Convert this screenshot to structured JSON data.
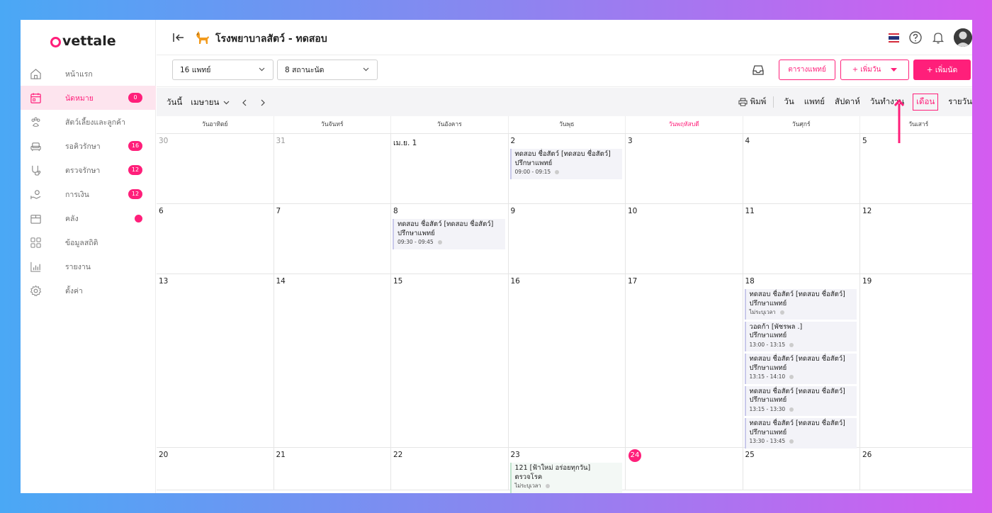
{
  "logo": {
    "text": "vettale"
  },
  "sidebar": {
    "items": [
      {
        "label": "หน้าแรก",
        "icon": "home-icon",
        "active": false,
        "badge": ""
      },
      {
        "label": "นัดหมาย",
        "icon": "calendar-icon",
        "active": true,
        "badge": "0"
      },
      {
        "label": "สัตว์เลี้ยงและลูกค้า",
        "icon": "paw-icon",
        "active": false,
        "badge": ""
      },
      {
        "label": "รอคิวรักษา",
        "icon": "sofa-icon",
        "active": false,
        "badge": "16"
      },
      {
        "label": "ตรวจรักษา",
        "icon": "stethoscope-icon",
        "active": false,
        "badge": "12"
      },
      {
        "label": "การเงิน",
        "icon": "payment-hand-icon",
        "active": false,
        "badge": "12"
      },
      {
        "label": "คลัง",
        "icon": "box-icon",
        "active": false,
        "badge": ""
      },
      {
        "label": "ข้อมูลสถิติ",
        "icon": "grid-stats-icon",
        "active": false,
        "badge": ""
      },
      {
        "label": "รายงาน",
        "icon": "bar-chart-icon",
        "active": false,
        "badge": ""
      },
      {
        "label": "ตั้งค่า",
        "icon": "gear-icon",
        "active": false,
        "badge": ""
      }
    ]
  },
  "topbar": {
    "title": "โรงพยาบาลสัตว์ - ทดสอบ"
  },
  "toolbar": {
    "doctor_select": "16 แพทย์",
    "status_select": "8 สถานะนัด",
    "schedule_btn": "ตารางแพทย์",
    "add_day_btn": "+ เพิ่มวัน",
    "add_appt_btn": "+ เพิ่มนัด"
  },
  "calendar_header": {
    "today": "วันนี้",
    "month": "เมษายน",
    "print": "พิมพ์",
    "views": [
      "วัน",
      "แพทย์",
      "สัปดาห์",
      "วันทำงาน",
      "เดือน",
      "รายวัน"
    ],
    "active_view": "เดือน"
  },
  "colors": {
    "accent": "#ff1f7a"
  },
  "weekdays": [
    "วันอาทิตย์",
    "วันจันทร์",
    "วันอังคาร",
    "วันพุธ",
    "วันพฤหัสบดี",
    "วันศุกร์",
    "วันเสาร์"
  ],
  "weeks": [
    {
      "days": [
        {
          "n": "30",
          "muted": true,
          "events": []
        },
        {
          "n": "31",
          "muted": true,
          "events": []
        },
        {
          "n": "เม.ย. 1",
          "events": []
        },
        {
          "n": "2",
          "events": [
            {
              "title": "ทดสอบ ชื่อสัตว์ [ทดสอบ ชื่อสัตว์]",
              "type": "ปรึกษาแพทย์",
              "time": "09:00 - 09:15"
            }
          ]
        },
        {
          "n": "3",
          "events": []
        },
        {
          "n": "4",
          "events": []
        },
        {
          "n": "5",
          "events": []
        }
      ]
    },
    {
      "days": [
        {
          "n": "6",
          "events": []
        },
        {
          "n": "7",
          "events": []
        },
        {
          "n": "8",
          "events": [
            {
              "title": "ทดสอบ ชื่อสัตว์ [ทดสอบ ชื่อสัตว์]",
              "type": "ปรึกษาแพทย์",
              "time": "09:30 - 09:45"
            }
          ]
        },
        {
          "n": "9",
          "events": []
        },
        {
          "n": "10",
          "events": []
        },
        {
          "n": "11",
          "events": []
        },
        {
          "n": "12",
          "events": []
        }
      ]
    },
    {
      "days": [
        {
          "n": "13",
          "events": []
        },
        {
          "n": "14",
          "events": []
        },
        {
          "n": "15",
          "events": []
        },
        {
          "n": "16",
          "events": []
        },
        {
          "n": "17",
          "events": []
        },
        {
          "n": "18",
          "events": [
            {
              "title": "ทดสอบ ชื่อสัตว์ [ทดสอบ ชื่อสัตว์]",
              "type": "ปรึกษาแพทย์",
              "time": "ไม่ระบุเวลา"
            },
            {
              "title": "วอดก้า [พัชรพล .]",
              "type": "ปรึกษาแพทย์",
              "time": "13:00 - 13:15"
            },
            {
              "title": "ทดสอบ ชื่อสัตว์ [ทดสอบ ชื่อสัตว์]",
              "type": "ปรึกษาแพทย์",
              "time": "13:15 - 14:10"
            },
            {
              "title": "ทดสอบ ชื่อสัตว์ [ทดสอบ ชื่อสัตว์]",
              "type": "ปรึกษาแพทย์",
              "time": "13:15 - 13:30"
            },
            {
              "title": "ทดสอบ ชื่อสัตว์ [ทดสอบ ชื่อสัตว์]",
              "type": "ปรึกษาแพทย์",
              "time": "13:30 - 13:45"
            }
          ]
        },
        {
          "n": "19",
          "events": []
        }
      ]
    },
    {
      "days": [
        {
          "n": "20",
          "events": []
        },
        {
          "n": "21",
          "events": []
        },
        {
          "n": "22",
          "events": []
        },
        {
          "n": "23",
          "events": [
            {
              "title": "121 [ฟ้าใหม่ อร่อยทุกวัน]",
              "type": "ตรวจโรค",
              "time": "ไม่ระบุเวลา",
              "green": true
            }
          ]
        },
        {
          "n": "24",
          "today": true,
          "events": []
        },
        {
          "n": "25",
          "events": []
        },
        {
          "n": "26",
          "events": []
        }
      ]
    }
  ]
}
